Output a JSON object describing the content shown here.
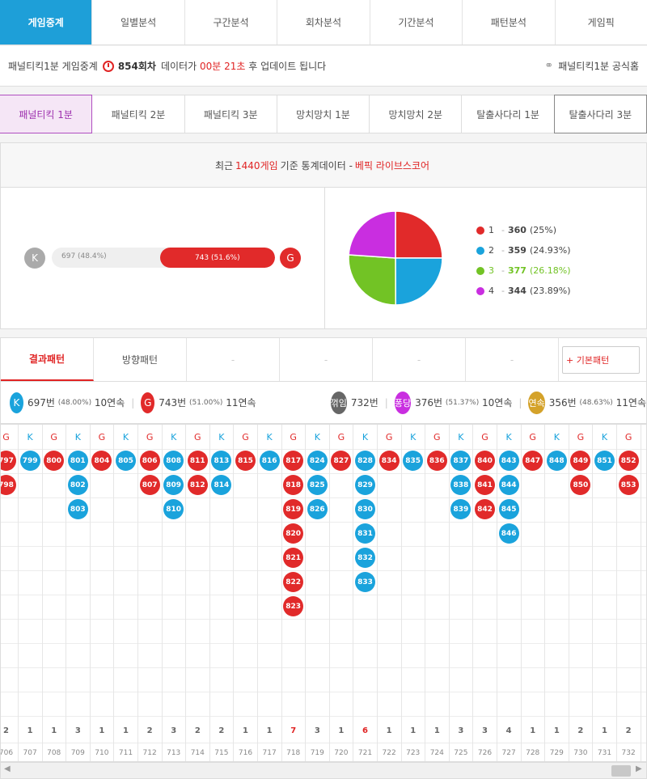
{
  "nav": {
    "tabs": [
      "게임중계",
      "일별분석",
      "구간분석",
      "회차분석",
      "기간분석",
      "패턴분석",
      "게임픽"
    ],
    "active": 0
  },
  "info": {
    "prefix": "패널티킥1분 게임중계",
    "round": "854회차",
    "mid": "데이터가",
    "timer": "00분 21초",
    "suffix": "후 업데이트 됩니다",
    "right_link": "패널티킥1분 공식홈"
  },
  "games": {
    "tabs": [
      "패널티킥 1분",
      "패널티킥 2분",
      "패널티킥 3분",
      "망치망치 1분",
      "망치망치 2분",
      "탈출사다리 1분",
      "탈출사다리 3분"
    ],
    "active": 0
  },
  "stats": {
    "head_pre": "최근",
    "head_count": "1440게임",
    "head_mid": "기준 통계데이터 -",
    "head_brand": "베픽 라이브스코어",
    "k_label": "K",
    "g_label": "G",
    "k_text": "697 (48.4%)",
    "g_text": "743 (51.6%)",
    "k_fraction": 0.484,
    "g_fraction": 0.516
  },
  "pie": {
    "slices": [
      {
        "label": "1",
        "value": 360,
        "pct": "(25%)",
        "color": "#e12a2a"
      },
      {
        "label": "2",
        "value": 359,
        "pct": "(24.93%)",
        "color": "#1aa3dc"
      },
      {
        "label": "3",
        "value": 377,
        "pct": "(26.18%)",
        "color": "#72c325"
      },
      {
        "label": "4",
        "value": 344,
        "pct": "(23.89%)",
        "color": "#c92ee0"
      }
    ]
  },
  "ptabs": {
    "tabs": [
      "결과패턴",
      "방향패턴",
      "-",
      "-",
      "-",
      "-"
    ],
    "active": 0,
    "button": "+ 기본패턴"
  },
  "summary": {
    "k_badge": "K",
    "k_count": "697번",
    "k_pct": "(48.00%)",
    "k_streak": "10연속",
    "g_badge": "G",
    "g_count": "743번",
    "g_pct": "(51.00%)",
    "g_streak": "11연속",
    "a_badge": "꺾임",
    "a_count": "732번",
    "b_badge": "퐁당",
    "b_count": "376번",
    "b_pct": "(51.37%)",
    "b_streak": "10연속",
    "c_badge": "연속",
    "c_count": "356번",
    "c_pct": "(48.63%)",
    "c_streak": "11연속"
  },
  "colors": {
    "K": "#1aa3dc",
    "G": "#e12a2a",
    "turn": "#666666",
    "pong": "#c92ee0",
    "streak": "#d4a22a"
  },
  "grid": {
    "columns": [
      {
        "type": "G",
        "balls": [
          "797",
          "798"
        ],
        "count": "2",
        "round": "706"
      },
      {
        "type": "K",
        "balls": [
          "799"
        ],
        "count": "1",
        "round": "707"
      },
      {
        "type": "G",
        "balls": [
          "800"
        ],
        "count": "1",
        "round": "708"
      },
      {
        "type": "K",
        "balls": [
          "801",
          "802",
          "803"
        ],
        "count": "3",
        "round": "709"
      },
      {
        "type": "G",
        "balls": [
          "804"
        ],
        "count": "1",
        "round": "710"
      },
      {
        "type": "K",
        "balls": [
          "805"
        ],
        "count": "1",
        "round": "711"
      },
      {
        "type": "G",
        "balls": [
          "806",
          "807"
        ],
        "count": "2",
        "round": "712"
      },
      {
        "type": "K",
        "balls": [
          "808",
          "809",
          "810"
        ],
        "count": "3",
        "round": "713"
      },
      {
        "type": "G",
        "balls": [
          "811",
          "812"
        ],
        "count": "2",
        "round": "714"
      },
      {
        "type": "K",
        "balls": [
          "813",
          "814"
        ],
        "count": "2",
        "round": "715"
      },
      {
        "type": "G",
        "balls": [
          "815"
        ],
        "count": "1",
        "round": "716"
      },
      {
        "type": "K",
        "balls": [
          "816"
        ],
        "count": "1",
        "round": "717"
      },
      {
        "type": "G",
        "balls": [
          "817",
          "818",
          "819",
          "820",
          "821",
          "822",
          "823"
        ],
        "count": "7",
        "round": "718",
        "hot": true
      },
      {
        "type": "K",
        "balls": [
          "824",
          "825",
          "826"
        ],
        "count": "3",
        "round": "719"
      },
      {
        "type": "G",
        "balls": [
          "827"
        ],
        "count": "1",
        "round": "720"
      },
      {
        "type": "K",
        "balls": [
          "828",
          "829",
          "830",
          "831",
          "832",
          "833"
        ],
        "count": "6",
        "round": "721",
        "hot": true
      },
      {
        "type": "G",
        "balls": [
          "834"
        ],
        "count": "1",
        "round": "722"
      },
      {
        "type": "K",
        "balls": [
          "835"
        ],
        "count": "1",
        "round": "723"
      },
      {
        "type": "G",
        "balls": [
          "836"
        ],
        "count": "1",
        "round": "724"
      },
      {
        "type": "K",
        "balls": [
          "837",
          "838",
          "839"
        ],
        "count": "3",
        "round": "725"
      },
      {
        "type": "G",
        "balls": [
          "840",
          "841",
          "842"
        ],
        "count": "3",
        "round": "726"
      },
      {
        "type": "K",
        "balls": [
          "843",
          "844",
          "845",
          "846"
        ],
        "count": "4",
        "round": "727"
      },
      {
        "type": "G",
        "balls": [
          "847"
        ],
        "count": "1",
        "round": "728"
      },
      {
        "type": "K",
        "balls": [
          "848"
        ],
        "count": "1",
        "round": "729"
      },
      {
        "type": "G",
        "balls": [
          "849",
          "850"
        ],
        "count": "2",
        "round": "730"
      },
      {
        "type": "K",
        "balls": [
          "851"
        ],
        "count": "1",
        "round": "731"
      },
      {
        "type": "G",
        "balls": [
          "852",
          "853"
        ],
        "count": "2",
        "round": "732"
      }
    ]
  },
  "scroll": {
    "left": "◀",
    "right": "▶"
  }
}
